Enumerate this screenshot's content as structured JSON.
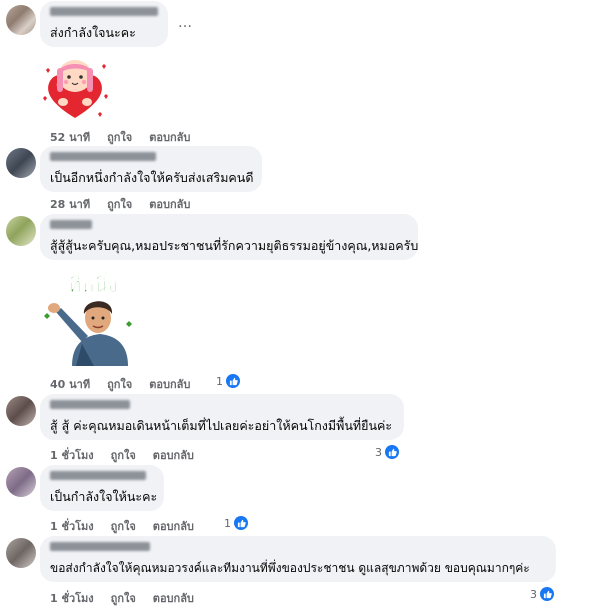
{
  "icons": {
    "like": "thumbs-up-icon",
    "more": "more-options-icon",
    "avatar": "blurred-avatar"
  },
  "colors": {
    "bubble": "#f0f2f5",
    "meta": "#65676b",
    "like": "#1877f2"
  },
  "comments": [
    {
      "text": "ส่งกำลังใจนะคะ",
      "more": "…",
      "sticker": "heart-girl-sticker",
      "time": "52 นาที",
      "like_label": "ถูกใจ",
      "reply_label": "ตอบกลับ",
      "reactions": ""
    },
    {
      "text": "เป็นอีกหนึ่งกำลังใจให้ครับส่งเสริมคนดี",
      "time": "28 นาที",
      "like_label": "ถูกใจ",
      "reply_label": "ตอบกลับ",
      "reactions": ""
    },
    {
      "text": "สู้สู้สู้นะครับคุณ,หมอประชาชนที่รักความยุติธรรมอยู่ข้างคุณ,หมอครับ",
      "sticker": "thi-nueng-pointing-sticker",
      "sticker_text": "ที่หนึ่ง",
      "time": "40 นาที",
      "like_label": "ถูกใจ",
      "reply_label": "ตอบกลับ",
      "reactions": "1"
    },
    {
      "text": "สู้ สู้ ค่ะคุณหมอเดินหน้าเต็มที่ไปเลยค่ะอย่าให้คนโกงมีพื้นที่ยืนค่ะ",
      "time": "1 ชั่วโมง",
      "like_label": "ถูกใจ",
      "reply_label": "ตอบกลับ",
      "reactions": "3"
    },
    {
      "text": "เป็นกำลังใจให้นะคะ",
      "time": "1 ชั่วโมง",
      "like_label": "ถูกใจ",
      "reply_label": "ตอบกลับ",
      "reactions": "1"
    },
    {
      "text": "ขอส่งกำลังใจให้คุณหมอวรงค์และทีมงานที่พึ่งของประชาชน ดูแลสุขภาพด้วย ขอบคุณมากๆค่ะ",
      "time": "1 ชั่วโมง",
      "like_label": "ถูกใจ",
      "reply_label": "ตอบกลับ",
      "reactions": "3"
    }
  ]
}
